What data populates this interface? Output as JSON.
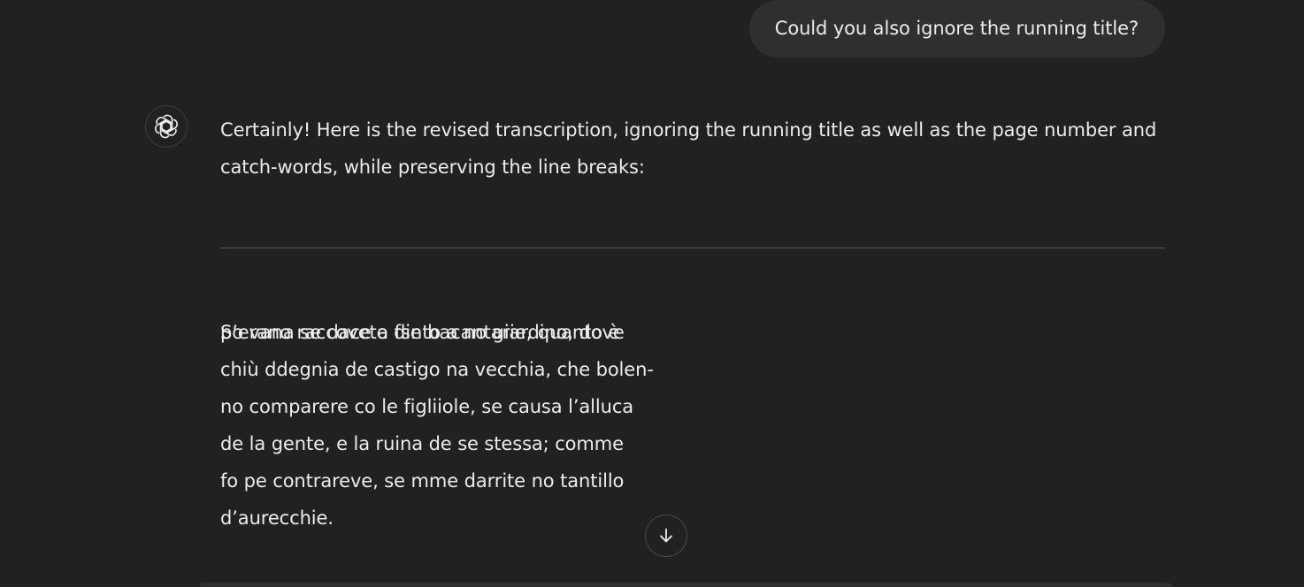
{
  "user_message": {
    "text": "Could you also ignore the running title?"
  },
  "assistant": {
    "avatar_icon": "openai-logo-icon",
    "intro_line_1": "Certainly! Here is the revised transcription, ignoring the running title as well as the page number and",
    "intro_line_2": "catch-words, while preserving the line breaks:",
    "transcription_lines": [
      "po vana se dace a fse bacantarie, quanto è",
      "chiù ddegnia de castigo na vecchia, che bolen-",
      "no comparere co le figliiole, se causa l’alluca",
      "de la gente, e la ruina de se stessa; comme",
      "fo pe contrareve, se mme darrite no tantillo",
      "d’aurecchie."
    ],
    "next_paragraph": "S’erano raccovete dinto a no giardino, dove"
  },
  "controls": {
    "scroll_down_icon": "arrow-down-icon"
  },
  "colors": {
    "background": "#212121",
    "bubble": "#2f2f2f",
    "text": "#ececec",
    "divider": "#5a5a5a"
  }
}
